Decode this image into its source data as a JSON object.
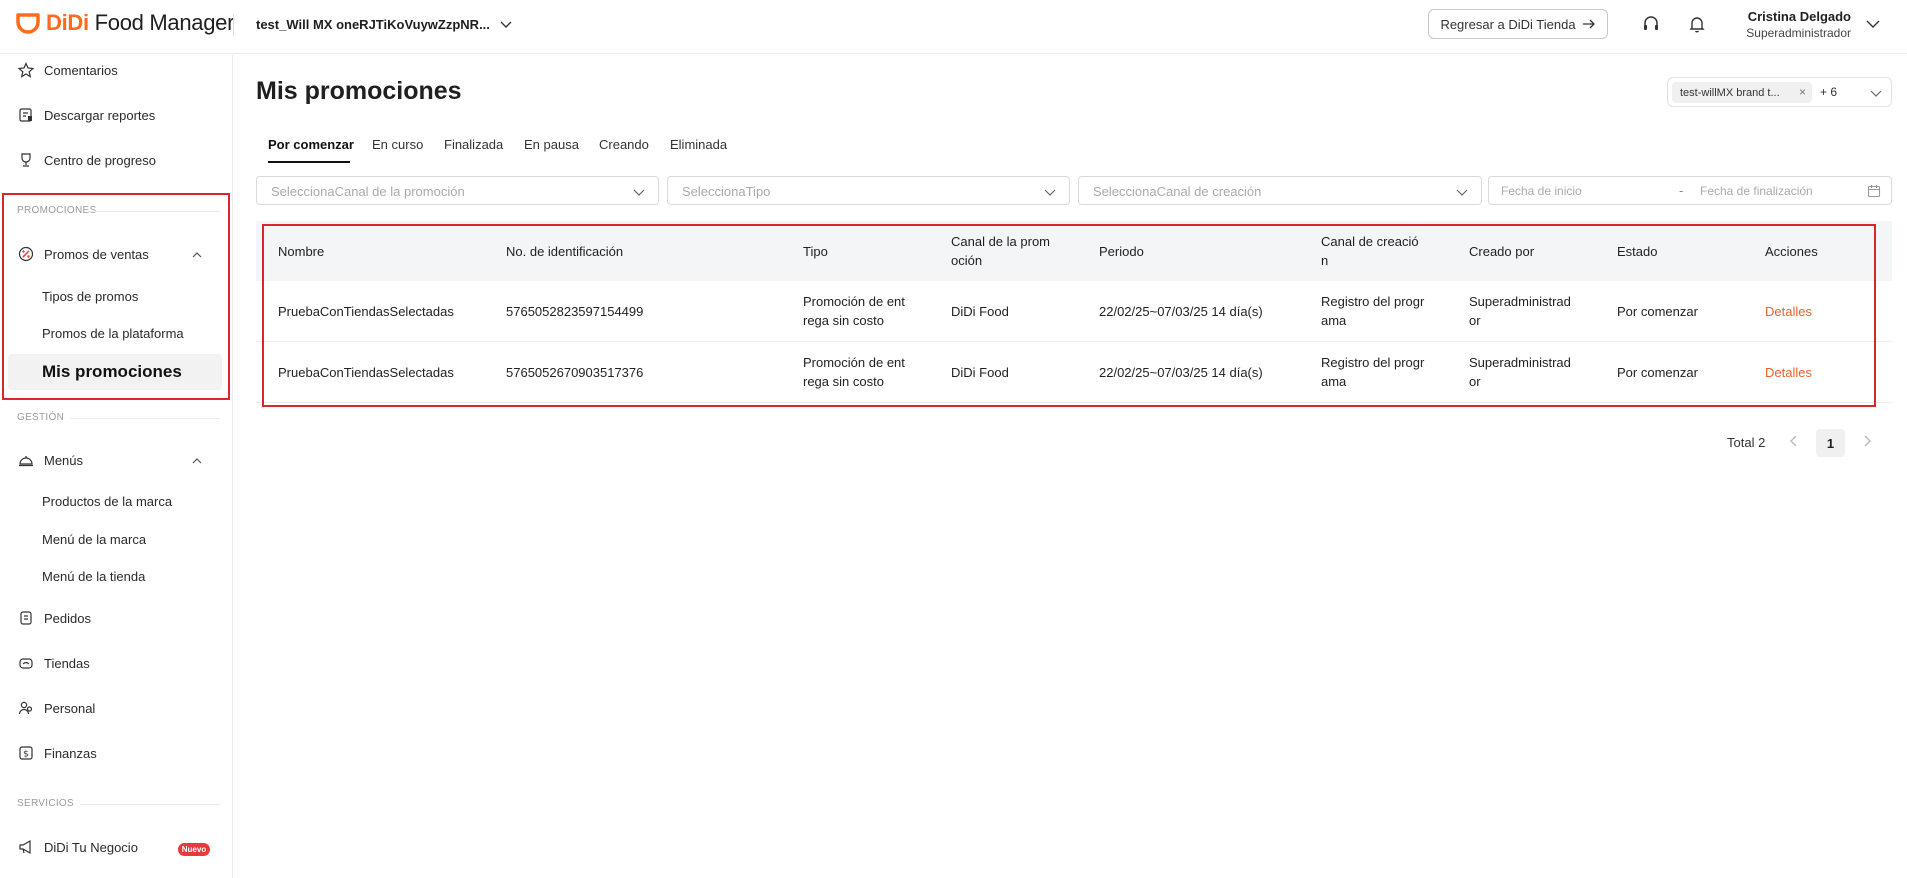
{
  "header": {
    "logo_didi": "DiDi",
    "logo_product": "Food Manager",
    "store_name": "test_Will MX oneRJTiKoVuywZzpNR...",
    "back_button": "Regresar a DiDi Tienda",
    "user_name": "Cristina Delgado",
    "user_role": "Superadministrador"
  },
  "sidebar": {
    "top_items": [
      {
        "label": "Comentarios",
        "icon": "star-icon"
      },
      {
        "label": "Descargar reportes",
        "icon": "report-icon"
      },
      {
        "label": "Centro de progreso",
        "icon": "trophy-icon"
      }
    ],
    "section_promos": "PROMOCIONES",
    "promos_group": "Promos de ventas",
    "promos_sub": [
      "Tipos de promos",
      "Promos de la plataforma",
      "Mis promociones"
    ],
    "section_gestion": "GESTIÓN",
    "menus_group": "Menús",
    "menus_sub": [
      "Productos de la marca",
      "Menú de la marca",
      "Menú de la tienda"
    ],
    "gestion_items": [
      {
        "label": "Pedidos",
        "icon": "orders-icon"
      },
      {
        "label": "Tiendas",
        "icon": "store-icon"
      },
      {
        "label": "Personal",
        "icon": "people-icon"
      },
      {
        "label": "Finanzas",
        "icon": "finance-icon"
      }
    ],
    "section_servicios": "SERVICIOS",
    "servicios_item": "DiDi Tu Negocio",
    "badge_new": "Nuevo"
  },
  "main": {
    "title": "Mis promociones",
    "brand_tag": "test-willMX brand t...",
    "brand_more": "+ 6",
    "tabs": [
      "Por comenzar",
      "En curso",
      "Finalizada",
      "En pausa",
      "Creando",
      "Eliminada"
    ],
    "filters": {
      "channel": "SeleccionaCanal de la promoción",
      "type": "SeleccionaTipo",
      "creation_channel": "SeleccionaCanal de creación",
      "date_start": "Fecha de inicio",
      "date_sep": "-",
      "date_end": "Fecha de finalización"
    },
    "table": {
      "headers": {
        "name": "Nombre",
        "id": "No. de identificación",
        "type": "Tipo",
        "channel_1": "Canal de la prom",
        "channel_2": "oción",
        "period": "Periodo",
        "creation_1": "Canal de creació",
        "creation_2": "n",
        "created_by": "Creado por",
        "status": "Estado",
        "actions": "Acciones"
      },
      "rows": [
        {
          "name": "PruebaConTiendasSelectadas",
          "id": "5765052823597154499",
          "type_1": "Promoción de ent",
          "type_2": "rega sin costo",
          "channel": "DiDi Food",
          "period": "22/02/25~07/03/25 14 día(s)",
          "creation_1": "Registro del progr",
          "creation_2": "ama",
          "created_by_1": "Superadministrad",
          "created_by_2": "or",
          "status": "Por comenzar",
          "action": "Detalles"
        },
        {
          "name": "PruebaConTiendasSelectadas",
          "id": "5765052670903517376",
          "type_1": "Promoción de ent",
          "type_2": "rega sin costo",
          "channel": "DiDi Food",
          "period": "22/02/25~07/03/25 14 día(s)",
          "creation_1": "Registro del progr",
          "creation_2": "ama",
          "created_by_1": "Superadministrad",
          "created_by_2": "or",
          "status": "Por comenzar",
          "action": "Detalles"
        }
      ]
    },
    "pagination": {
      "total": "Total 2",
      "current": "1"
    }
  },
  "colors": {
    "accent": "#ff6b1a",
    "link": "#e8632a",
    "highlight_box": "#d9262c"
  }
}
